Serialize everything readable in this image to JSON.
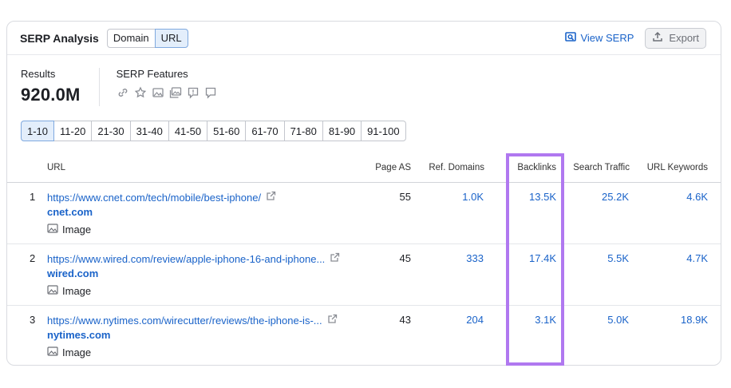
{
  "header": {
    "title": "SERP Analysis",
    "toggle": [
      "Domain",
      "URL"
    ],
    "active_toggle": "URL",
    "view_serp": "View SERP",
    "export": "Export"
  },
  "summary": {
    "results_label": "Results",
    "results_value": "920.0M",
    "features_label": "SERP Features",
    "feature_icons": [
      "link-icon",
      "star-icon",
      "image-icon",
      "image-pack-icon",
      "feedback-icon",
      "comment-icon"
    ]
  },
  "pagination": [
    "1-10",
    "11-20",
    "21-30",
    "31-40",
    "41-50",
    "51-60",
    "61-70",
    "71-80",
    "81-90",
    "91-100"
  ],
  "active_page": "1-10",
  "columns": {
    "url": "URL",
    "page_as": "Page AS",
    "ref_domains": "Ref. Domains",
    "backlinks": "Backlinks",
    "search_traffic": "Search Traffic",
    "url_keywords": "URL Keywords"
  },
  "rows": [
    {
      "rank": "1",
      "url": "https://www.cnet.com/tech/mobile/best-iphone/",
      "domain": "cnet.com",
      "feature": "Image",
      "page_as": "55",
      "ref_domains": "1.0K",
      "backlinks": "13.5K",
      "search_traffic": "25.2K",
      "url_keywords": "4.6K"
    },
    {
      "rank": "2",
      "url": "https://www.wired.com/review/apple-iphone-16-and-iphone...",
      "domain": "wired.com",
      "feature": "Image",
      "page_as": "45",
      "ref_domains": "333",
      "backlinks": "17.4K",
      "search_traffic": "5.5K",
      "url_keywords": "4.7K"
    },
    {
      "rank": "3",
      "url": "https://www.nytimes.com/wirecutter/reviews/the-iphone-is-...",
      "domain": "nytimes.com",
      "feature": "Image",
      "page_as": "43",
      "ref_domains": "204",
      "backlinks": "3.1K",
      "search_traffic": "5.0K",
      "url_keywords": "18.9K"
    }
  ],
  "colors": {
    "link": "#1a63c9",
    "highlight": "#b078f0",
    "active_bg": "#e3eefb"
  }
}
